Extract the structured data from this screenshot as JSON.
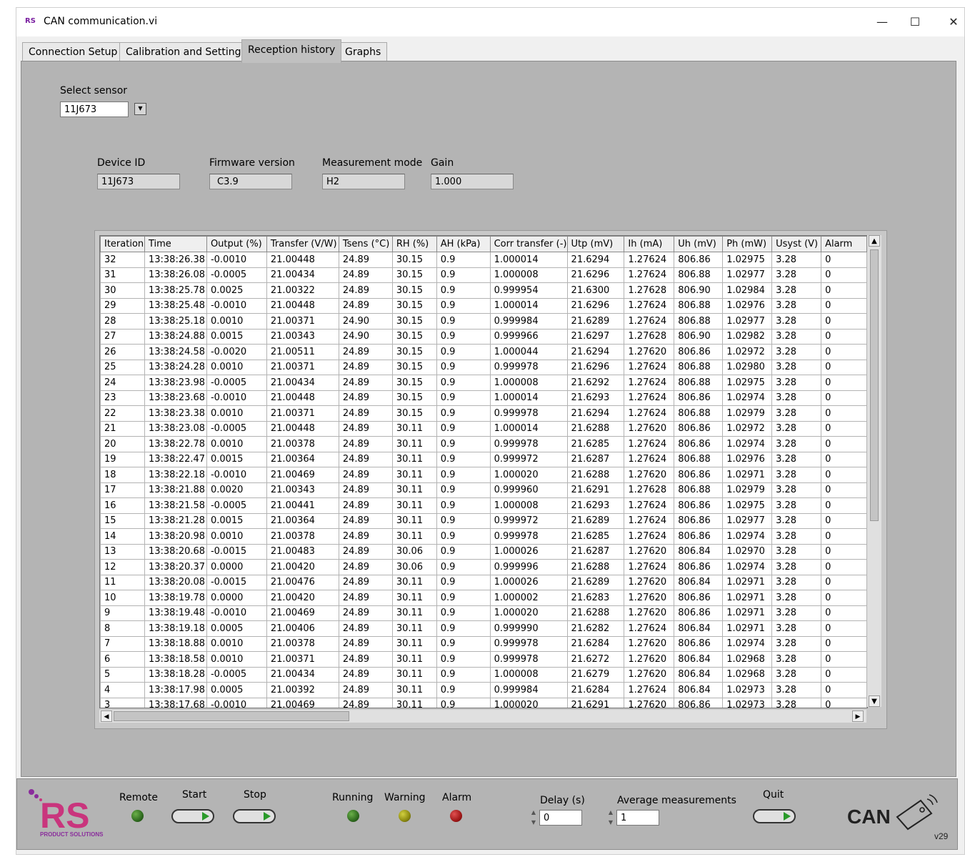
{
  "window": {
    "title": "CAN communication.vi",
    "logo": "RS"
  },
  "tabs": [
    "Connection Setup",
    "Calibration and Settings",
    "Reception history",
    "Graphs"
  ],
  "select_sensor": {
    "label": "Select sensor",
    "value": "11J673"
  },
  "info": {
    "device_id": {
      "label": "Device ID",
      "value": "11J673"
    },
    "firmware": {
      "label": "Firmware version",
      "value": "C3.9"
    },
    "mode": {
      "label": "Measurement mode",
      "value": "H2"
    },
    "gain": {
      "label": "Gain",
      "value": "1.000"
    }
  },
  "table": {
    "headers": [
      "Iteration",
      "Time",
      "Output (%)",
      "Transfer (V/W)",
      "Tsens (°C)",
      "RH (%)",
      "AH (kPa)",
      "Corr transfer (-)",
      "Utp (mV)",
      "Ih (mA)",
      "Uh (mV)",
      "Ph (mW)",
      "Usyst (V)",
      "Alarm"
    ],
    "rows": [
      [
        "32",
        "13:38:26.38",
        "-0.0010",
        "21.00448",
        "24.89",
        "30.15",
        "0.9",
        "1.000014",
        "21.6294",
        "1.27624",
        "806.86",
        "1.02975",
        "3.28",
        "0"
      ],
      [
        "31",
        "13:38:26.08",
        "-0.0005",
        "21.00434",
        "24.89",
        "30.15",
        "0.9",
        "1.000008",
        "21.6296",
        "1.27624",
        "806.88",
        "1.02977",
        "3.28",
        "0"
      ],
      [
        "30",
        "13:38:25.78",
        "0.0025",
        "21.00322",
        "24.89",
        "30.15",
        "0.9",
        "0.999954",
        "21.6300",
        "1.27628",
        "806.90",
        "1.02984",
        "3.28",
        "0"
      ],
      [
        "29",
        "13:38:25.48",
        "-0.0010",
        "21.00448",
        "24.89",
        "30.15",
        "0.9",
        "1.000014",
        "21.6296",
        "1.27624",
        "806.88",
        "1.02976",
        "3.28",
        "0"
      ],
      [
        "28",
        "13:38:25.18",
        "0.0010",
        "21.00371",
        "24.90",
        "30.15",
        "0.9",
        "0.999984",
        "21.6289",
        "1.27624",
        "806.88",
        "1.02977",
        "3.28",
        "0"
      ],
      [
        "27",
        "13:38:24.88",
        "0.0015",
        "21.00343",
        "24.90",
        "30.15",
        "0.9",
        "0.999966",
        "21.6297",
        "1.27628",
        "806.90",
        "1.02982",
        "3.28",
        "0"
      ],
      [
        "26",
        "13:38:24.58",
        "-0.0020",
        "21.00511",
        "24.89",
        "30.15",
        "0.9",
        "1.000044",
        "21.6294",
        "1.27620",
        "806.86",
        "1.02972",
        "3.28",
        "0"
      ],
      [
        "25",
        "13:38:24.28",
        "0.0010",
        "21.00371",
        "24.89",
        "30.15",
        "0.9",
        "0.999978",
        "21.6296",
        "1.27624",
        "806.88",
        "1.02980",
        "3.28",
        "0"
      ],
      [
        "24",
        "13:38:23.98",
        "-0.0005",
        "21.00434",
        "24.89",
        "30.15",
        "0.9",
        "1.000008",
        "21.6292",
        "1.27624",
        "806.88",
        "1.02975",
        "3.28",
        "0"
      ],
      [
        "23",
        "13:38:23.68",
        "-0.0010",
        "21.00448",
        "24.89",
        "30.15",
        "0.9",
        "1.000014",
        "21.6293",
        "1.27624",
        "806.86",
        "1.02974",
        "3.28",
        "0"
      ],
      [
        "22",
        "13:38:23.38",
        "0.0010",
        "21.00371",
        "24.89",
        "30.15",
        "0.9",
        "0.999978",
        "21.6294",
        "1.27624",
        "806.88",
        "1.02979",
        "3.28",
        "0"
      ],
      [
        "21",
        "13:38:23.08",
        "-0.0005",
        "21.00448",
        "24.89",
        "30.11",
        "0.9",
        "1.000014",
        "21.6288",
        "1.27620",
        "806.86",
        "1.02972",
        "3.28",
        "0"
      ],
      [
        "20",
        "13:38:22.78",
        "0.0010",
        "21.00378",
        "24.89",
        "30.11",
        "0.9",
        "0.999978",
        "21.6285",
        "1.27624",
        "806.86",
        "1.02974",
        "3.28",
        "0"
      ],
      [
        "19",
        "13:38:22.47",
        "0.0015",
        "21.00364",
        "24.89",
        "30.11",
        "0.9",
        "0.999972",
        "21.6287",
        "1.27624",
        "806.88",
        "1.02976",
        "3.28",
        "0"
      ],
      [
        "18",
        "13:38:22.18",
        "-0.0010",
        "21.00469",
        "24.89",
        "30.11",
        "0.9",
        "1.000020",
        "21.6288",
        "1.27620",
        "806.86",
        "1.02971",
        "3.28",
        "0"
      ],
      [
        "17",
        "13:38:21.88",
        "0.0020",
        "21.00343",
        "24.89",
        "30.11",
        "0.9",
        "0.999960",
        "21.6291",
        "1.27628",
        "806.88",
        "1.02979",
        "3.28",
        "0"
      ],
      [
        "16",
        "13:38:21.58",
        "-0.0005",
        "21.00441",
        "24.89",
        "30.11",
        "0.9",
        "1.000008",
        "21.6293",
        "1.27624",
        "806.86",
        "1.02975",
        "3.28",
        "0"
      ],
      [
        "15",
        "13:38:21.28",
        "0.0015",
        "21.00364",
        "24.89",
        "30.11",
        "0.9",
        "0.999972",
        "21.6289",
        "1.27624",
        "806.86",
        "1.02977",
        "3.28",
        "0"
      ],
      [
        "14",
        "13:38:20.98",
        "0.0010",
        "21.00378",
        "24.89",
        "30.11",
        "0.9",
        "0.999978",
        "21.6285",
        "1.27624",
        "806.86",
        "1.02974",
        "3.28",
        "0"
      ],
      [
        "13",
        "13:38:20.68",
        "-0.0015",
        "21.00483",
        "24.89",
        "30.06",
        "0.9",
        "1.000026",
        "21.6287",
        "1.27620",
        "806.84",
        "1.02970",
        "3.28",
        "0"
      ],
      [
        "12",
        "13:38:20.37",
        "0.0000",
        "21.00420",
        "24.89",
        "30.06",
        "0.9",
        "0.999996",
        "21.6288",
        "1.27624",
        "806.86",
        "1.02974",
        "3.28",
        "0"
      ],
      [
        "11",
        "13:38:20.08",
        "-0.0015",
        "21.00476",
        "24.89",
        "30.11",
        "0.9",
        "1.000026",
        "21.6289",
        "1.27620",
        "806.84",
        "1.02971",
        "3.28",
        "0"
      ],
      [
        "10",
        "13:38:19.78",
        "0.0000",
        "21.00420",
        "24.89",
        "30.11",
        "0.9",
        "1.000002",
        "21.6283",
        "1.27620",
        "806.86",
        "1.02971",
        "3.28",
        "0"
      ],
      [
        "9",
        "13:38:19.48",
        "-0.0010",
        "21.00469",
        "24.89",
        "30.11",
        "0.9",
        "1.000020",
        "21.6288",
        "1.27620",
        "806.86",
        "1.02971",
        "3.28",
        "0"
      ],
      [
        "8",
        "13:38:19.18",
        "0.0005",
        "21.00406",
        "24.89",
        "30.11",
        "0.9",
        "0.999990",
        "21.6282",
        "1.27624",
        "806.84",
        "1.02971",
        "3.28",
        "0"
      ],
      [
        "7",
        "13:38:18.88",
        "0.0010",
        "21.00378",
        "24.89",
        "30.11",
        "0.9",
        "0.999978",
        "21.6284",
        "1.27620",
        "806.86",
        "1.02974",
        "3.28",
        "0"
      ],
      [
        "6",
        "13:38:18.58",
        "0.0010",
        "21.00371",
        "24.89",
        "30.11",
        "0.9",
        "0.999978",
        "21.6272",
        "1.27620",
        "806.84",
        "1.02968",
        "3.28",
        "0"
      ],
      [
        "5",
        "13:38:18.28",
        "-0.0005",
        "21.00434",
        "24.89",
        "30.11",
        "0.9",
        "1.000008",
        "21.6279",
        "1.27620",
        "806.84",
        "1.02968",
        "3.28",
        "0"
      ],
      [
        "4",
        "13:38:17.98",
        "0.0005",
        "21.00392",
        "24.89",
        "30.11",
        "0.9",
        "0.999984",
        "21.6284",
        "1.27624",
        "806.84",
        "1.02973",
        "3.28",
        "0"
      ],
      [
        "3",
        "13:38:17.68",
        "-0.0010",
        "21.00469",
        "24.89",
        "30.11",
        "0.9",
        "1.000020",
        "21.6291",
        "1.27620",
        "806.86",
        "1.02973",
        "3.28",
        "0"
      ]
    ]
  },
  "controls": {
    "remote": "Remote",
    "start": "Start",
    "stop": "Stop",
    "running": "Running",
    "warning": "Warning",
    "alarm": "Alarm",
    "delay": {
      "label": "Delay (s)",
      "value": "0"
    },
    "average": {
      "label": "Average measurements",
      "value": "1"
    },
    "quit": "Quit"
  },
  "branding": {
    "rs_text": "RS",
    "rs_sub": "PRODUCT SOLUTIONS",
    "can_text": "CAN",
    "version": "v29"
  },
  "colors": {
    "led_green": "#2f6b1f",
    "led_yellow": "#8c8a10",
    "led_red": "#a01818",
    "rs_purple": "#8a2d9c",
    "rs_pink": "#c9357d"
  }
}
